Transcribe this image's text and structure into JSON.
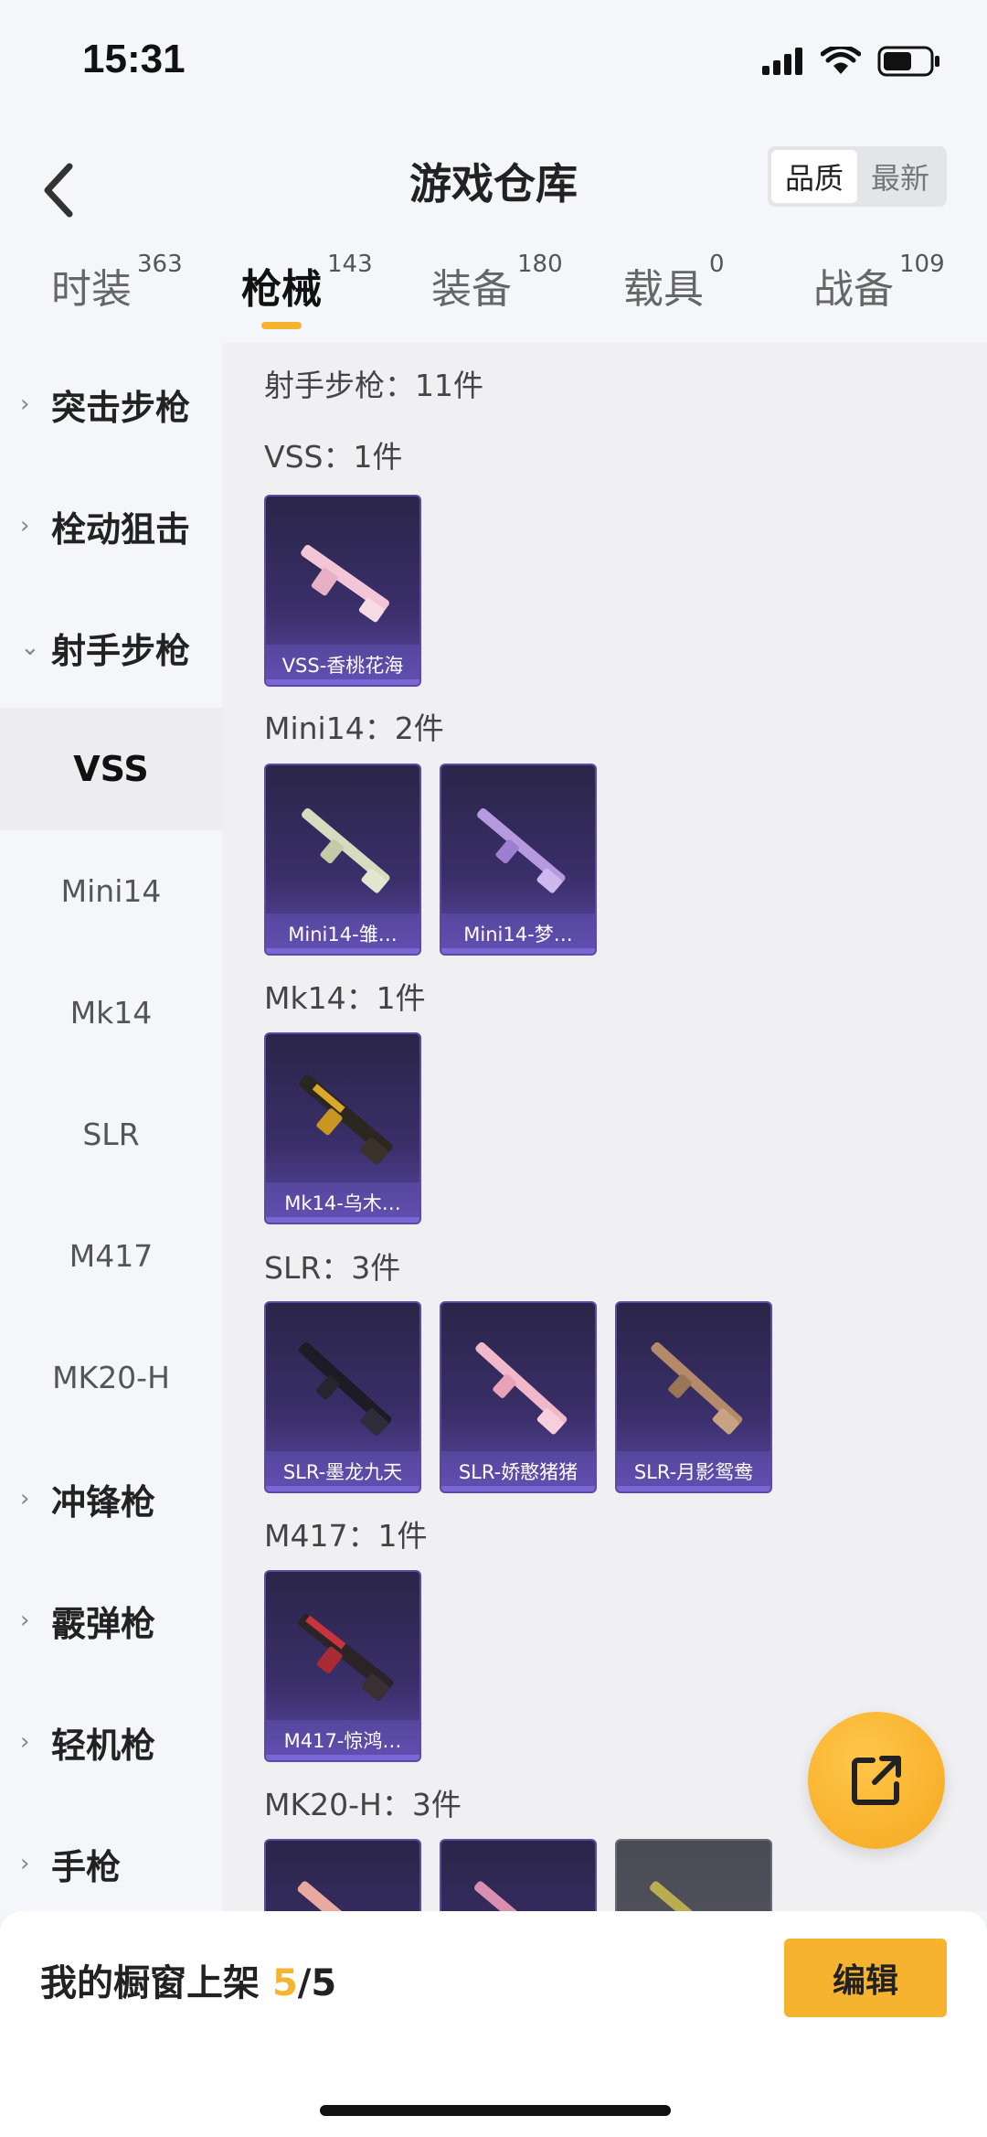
{
  "status": {
    "time": "15:31"
  },
  "header": {
    "title": "游戏仓库",
    "sort": [
      "品质",
      "最新"
    ]
  },
  "tabs": [
    {
      "label": "时装",
      "count": "363"
    },
    {
      "label": "枪械",
      "count": "143"
    },
    {
      "label": "装备",
      "count": "180"
    },
    {
      "label": "载具",
      "count": "0"
    },
    {
      "label": "战备",
      "count": "109"
    }
  ],
  "sidebar": {
    "categories": [
      "突击步枪",
      "栓动狙击",
      "射手步枪",
      "冲锋枪",
      "霰弹枪",
      "轻机枪",
      "手枪"
    ],
    "subs": [
      "VSS",
      "Mini14",
      "Mk14",
      "SLR",
      "M417",
      "MK20-H"
    ]
  },
  "content": {
    "summary": "射手步枪：11件",
    "sections": [
      {
        "label": "VSS：1件",
        "items": [
          "VSS-香桃花海"
        ]
      },
      {
        "label": "Mini14：2件",
        "items": [
          "Mini14-雏…",
          "Mini14-梦…"
        ]
      },
      {
        "label": "Mk14：1件",
        "items": [
          "Mk14-乌木…"
        ]
      },
      {
        "label": "SLR：3件",
        "items": [
          "SLR-墨龙九天",
          "SLR-娇憨猪猪",
          "SLR-月影鸳鸯"
        ]
      },
      {
        "label": "M417：1件",
        "items": [
          "M417-惊鸿…"
        ]
      },
      {
        "label": "MK20-H：3件"
      }
    ]
  },
  "bottom": {
    "showcase_label": "我的橱窗上架",
    "showcase_current": "5",
    "showcase_sep_total": "/5",
    "edit_label": "编辑"
  },
  "colors": {
    "accent": "#f5b32f",
    "card_purple": "#3a2f6a"
  },
  "icons": [
    "back-arrow-icon",
    "signal-icon",
    "wifi-icon",
    "battery-icon",
    "chevron-right-icon",
    "chevron-down-icon",
    "share-icon"
  ]
}
